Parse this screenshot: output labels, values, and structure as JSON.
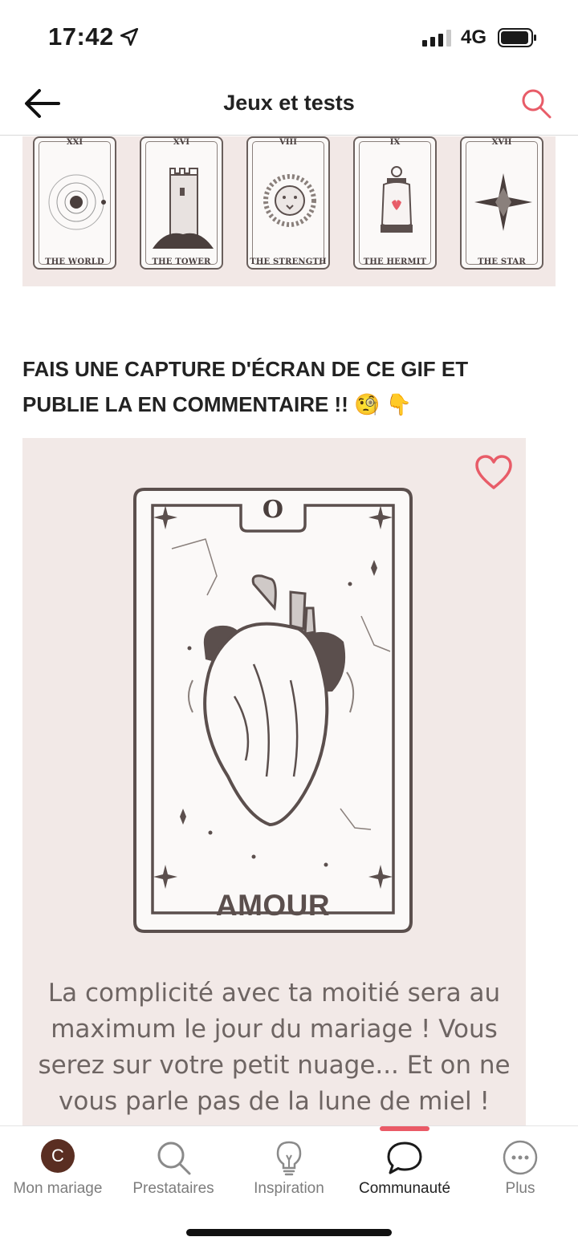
{
  "status_bar": {
    "time": "17:42",
    "network": "4G",
    "signal_bars_filled": 3,
    "signal_bars_total": 4,
    "icons": [
      "location-arrow-icon",
      "signal-icon",
      "battery-icon"
    ]
  },
  "header": {
    "title": "Jeux et tests",
    "back_icon": "back-arrow-icon",
    "search_icon": "search-icon"
  },
  "tarot_strip": {
    "cards": [
      {
        "numeral": "XXI",
        "name": "THE WORLD",
        "icon": "world-orbit-icon"
      },
      {
        "numeral": "XVI",
        "name": "THE TOWER",
        "icon": "tower-icon"
      },
      {
        "numeral": "VIII",
        "name": "THE STRENGTH",
        "icon": "lion-icon"
      },
      {
        "numeral": "IX",
        "name": "THE HERMIT",
        "icon": "lantern-icon"
      },
      {
        "numeral": "XVII",
        "name": "THE STAR",
        "icon": "compass-star-icon"
      }
    ]
  },
  "post": {
    "heading": "FAIS UNE CAPTURE D'ÉCRAN DE CE GIF ET PUBLIE LA EN COMMENTAIRE !! 🧐 👇"
  },
  "gif": {
    "card_numeral": "O",
    "card_title": "AMOUR",
    "text": "La complicité avec ta moitié sera au maximum le jour du mariage ! Vous serez sur votre petit nuage... Et on ne vous parle pas de la lune de miel !",
    "heart_icon": "heart-outline-icon",
    "colors": {
      "panel": "#f2e9e7",
      "heart": "#e85c68",
      "ink": "#5b4f4d"
    }
  },
  "tab_bar": {
    "active_index": 3,
    "accent_color": "#ea5a66",
    "tabs": [
      {
        "label": "Mon mariage",
        "icon": "avatar-icon",
        "avatar_letter": "C"
      },
      {
        "label": "Prestataires",
        "icon": "search-icon"
      },
      {
        "label": "Inspiration",
        "icon": "lightbulb-icon"
      },
      {
        "label": "Communauté",
        "icon": "chat-bubble-icon"
      },
      {
        "label": "Plus",
        "icon": "more-dots-icon"
      }
    ]
  }
}
